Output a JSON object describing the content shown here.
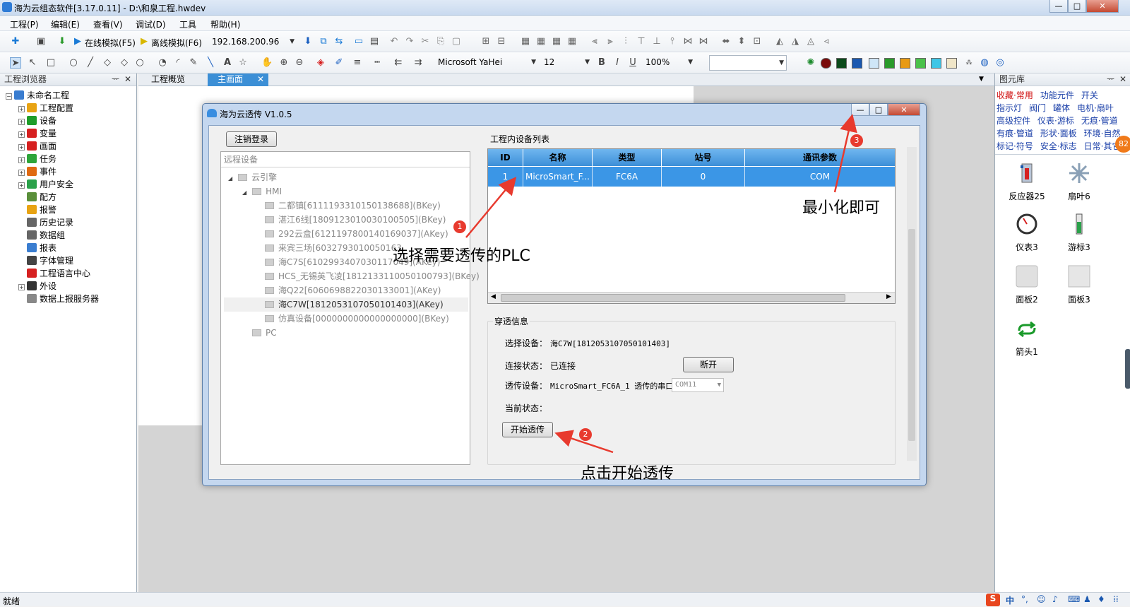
{
  "window": {
    "title": "海为云组态软件[3.17.0.11] - D:\\和泉工程.hwdev",
    "btn_min": "—",
    "btn_max": "□",
    "btn_close": "✕"
  },
  "menu": [
    "工程(P)",
    "编辑(E)",
    "查看(V)",
    "调试(D)",
    "工具",
    "帮助(H)"
  ],
  "toolbar1": {
    "online_sim": "在线模拟(F5)",
    "offline_sim": "离线模拟(F6)",
    "ip": "192.168.200.96"
  },
  "toolbar2": {
    "font": "Microsoft YaHei",
    "size": "12",
    "zoom": "100%",
    "bold": "B",
    "italic": "I",
    "underline": "U"
  },
  "left_panel": {
    "title": "工程浏览器",
    "pin": "ᅲ",
    "close": "✕",
    "root": "未命名工程",
    "items": [
      {
        "label": "工程配置",
        "color": "#e8a313",
        "expand": true
      },
      {
        "label": "设备",
        "color": "#1f9d2a",
        "expand": true
      },
      {
        "label": "变量",
        "color": "#d62020",
        "expand": true
      },
      {
        "label": "画面",
        "color": "#d62020",
        "expand": true
      },
      {
        "label": "任务",
        "color": "#2ea53a",
        "expand": true
      },
      {
        "label": "事件",
        "color": "#e06a12",
        "expand": true
      },
      {
        "label": "用户安全",
        "color": "#2aa14a",
        "expand": true
      },
      {
        "label": "配方",
        "color": "#5a8f3a",
        "expand": false
      },
      {
        "label": "报警",
        "color": "#e8a313",
        "expand": false
      },
      {
        "label": "历史记录",
        "color": "#666666",
        "expand": false
      },
      {
        "label": "数据组",
        "color": "#666666",
        "expand": false
      },
      {
        "label": "报表",
        "color": "#3a7dd0",
        "expand": false
      },
      {
        "label": "字体管理",
        "color": "#444444",
        "expand": false
      },
      {
        "label": "工程语言中心",
        "color": "#d62020",
        "expand": false
      },
      {
        "label": "外设",
        "color": "#333333",
        "expand": true
      },
      {
        "label": "数据上报服务器",
        "color": "#888888",
        "expand": false
      }
    ]
  },
  "tabs": [
    {
      "label": "工程概览",
      "close": ""
    },
    {
      "label": "主画面",
      "close": "✕"
    }
  ],
  "right_panel": {
    "title": "图元库",
    "categories": [
      [
        "收藏·常用",
        "功能元件",
        "开关"
      ],
      [
        "指示灯",
        "阀门",
        "罐体",
        "电机·扇叶"
      ],
      [
        "高级控件",
        "仪表·游标",
        "无痕·管道"
      ],
      [
        "有痕·管道",
        "形状·面板",
        "环境·自然"
      ],
      [
        "标记·符号",
        "安全·标志",
        "日常·其它"
      ]
    ],
    "items": [
      "反应器25",
      "扇叶6",
      "仪表3",
      "游标3",
      "面板2",
      "面板3",
      "箭头1"
    ],
    "badge": "82"
  },
  "status": {
    "text": "就绪",
    "ime": "中"
  },
  "dialog": {
    "title": "海为云透传 V1.0.5",
    "logout": "注销登录",
    "remote_header": "远程设备",
    "remote_tree": [
      {
        "label": "云引擎",
        "level": 0
      },
      {
        "label": "HMI",
        "level": 1
      },
      {
        "label": "二都镇[6111193310150138688](BKey)",
        "level": 2
      },
      {
        "label": "湛江6线[1809123010030100505](BKey)",
        "level": 2
      },
      {
        "label": "292云盒[6121197800140169037](AKey)",
        "level": 2
      },
      {
        "label": "来宾三场[6032793010050163",
        "level": 2
      },
      {
        "label": "海C7S[6102993407030117049](AKey)",
        "level": 2
      },
      {
        "label": "HCS_无锡英飞凌[1812133110050100793](BKey)",
        "level": 2
      },
      {
        "label": "海Q22[6060698822030133001](AKey)",
        "level": 2
      },
      {
        "label": "海C7W[1812053107050101403](AKey)",
        "level": 2,
        "selected": true
      },
      {
        "label": "仿真设备[0000000000000000000](BKey)",
        "level": 2
      },
      {
        "label": "PC",
        "level": 1
      }
    ],
    "device_list_title": "工程内设备列表",
    "columns": [
      "ID",
      "名称",
      "类型",
      "站号",
      "通讯参数"
    ],
    "rows": [
      [
        "1",
        "MicroSmart_F...",
        "FC6A",
        "0",
        "COM"
      ]
    ],
    "pt_info_title": "穿透信息",
    "sel_device_label": "选择设备：",
    "sel_device_value": "海C7W[1812053107050101403]",
    "conn_label": "连接状态：",
    "conn_value": "已连接",
    "disconnect": "断开",
    "pt_device_label": "透传设备：",
    "pt_device_value": "MicroSmart_FC6A_1 透传的串口",
    "com_port": "COM11",
    "cur_state_label": "当前状态：",
    "start_btn": "开始透传"
  },
  "annotations": {
    "a1": "选择需要透传的PLC",
    "a2": "点击开始透传",
    "a3": "最小化即可",
    "n1": "1",
    "n2": "2",
    "n3": "3"
  }
}
